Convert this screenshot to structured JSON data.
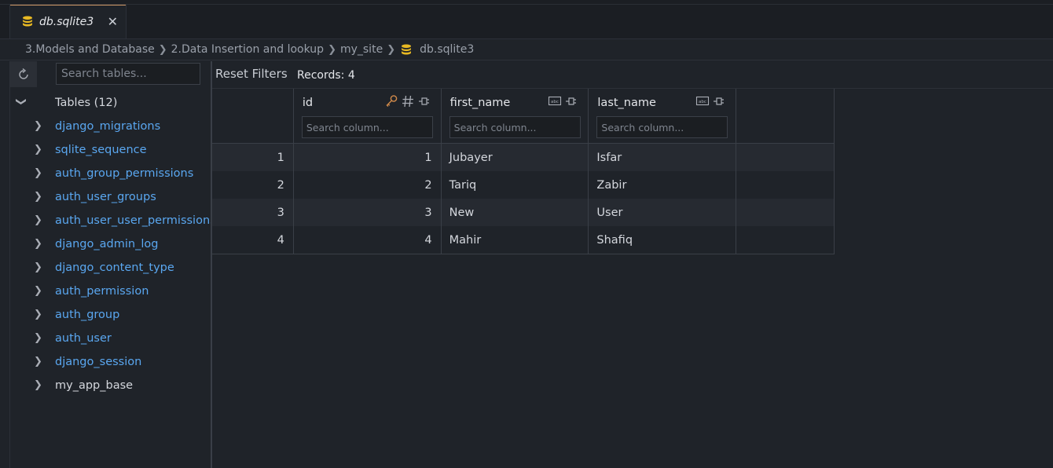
{
  "tab": {
    "label": "db.sqlite3",
    "close": "✕"
  },
  "breadcrumb": [
    "3.Models and Database",
    "2.Data Insertion and lookup",
    "my_site",
    "db.sqlite3"
  ],
  "sidebar": {
    "search_placeholder": "Search tables...",
    "root_label": "Tables (12)",
    "tables": [
      {
        "name": "django_migrations"
      },
      {
        "name": "sqlite_sequence"
      },
      {
        "name": "auth_group_permissions"
      },
      {
        "name": "auth_user_groups"
      },
      {
        "name": "auth_user_user_permissions"
      },
      {
        "name": "django_admin_log"
      },
      {
        "name": "django_content_type"
      },
      {
        "name": "auth_permission"
      },
      {
        "name": "auth_group"
      },
      {
        "name": "auth_user"
      },
      {
        "name": "django_session"
      },
      {
        "name": "my_app_base"
      }
    ]
  },
  "toolbar": {
    "reset_label": "Reset Filters",
    "records_label": "Records: 4"
  },
  "grid": {
    "columns": [
      {
        "name": "id",
        "placeholder": "Search column..."
      },
      {
        "name": "first_name",
        "placeholder": "Search column..."
      },
      {
        "name": "last_name",
        "placeholder": "Search column..."
      }
    ],
    "rows": [
      {
        "idx": "1",
        "id": "1",
        "first_name": "Jubayer",
        "last_name": "Isfar"
      },
      {
        "idx": "2",
        "id": "2",
        "first_name": "Tariq",
        "last_name": "Zabir"
      },
      {
        "idx": "3",
        "id": "3",
        "first_name": "New",
        "last_name": "User"
      },
      {
        "idx": "4",
        "id": "4",
        "first_name": "Mahir",
        "last_name": "Shafiq"
      }
    ]
  },
  "colors": {
    "accent_link": "#5aa7f0",
    "db_icon": "#e8b923",
    "key_icon": "#d18a4a"
  },
  "icons": [
    "database-icon",
    "close-icon",
    "chevron-right-icon",
    "refresh-icon",
    "key-icon",
    "hash-icon",
    "pin-icon",
    "text-type-icon"
  ]
}
